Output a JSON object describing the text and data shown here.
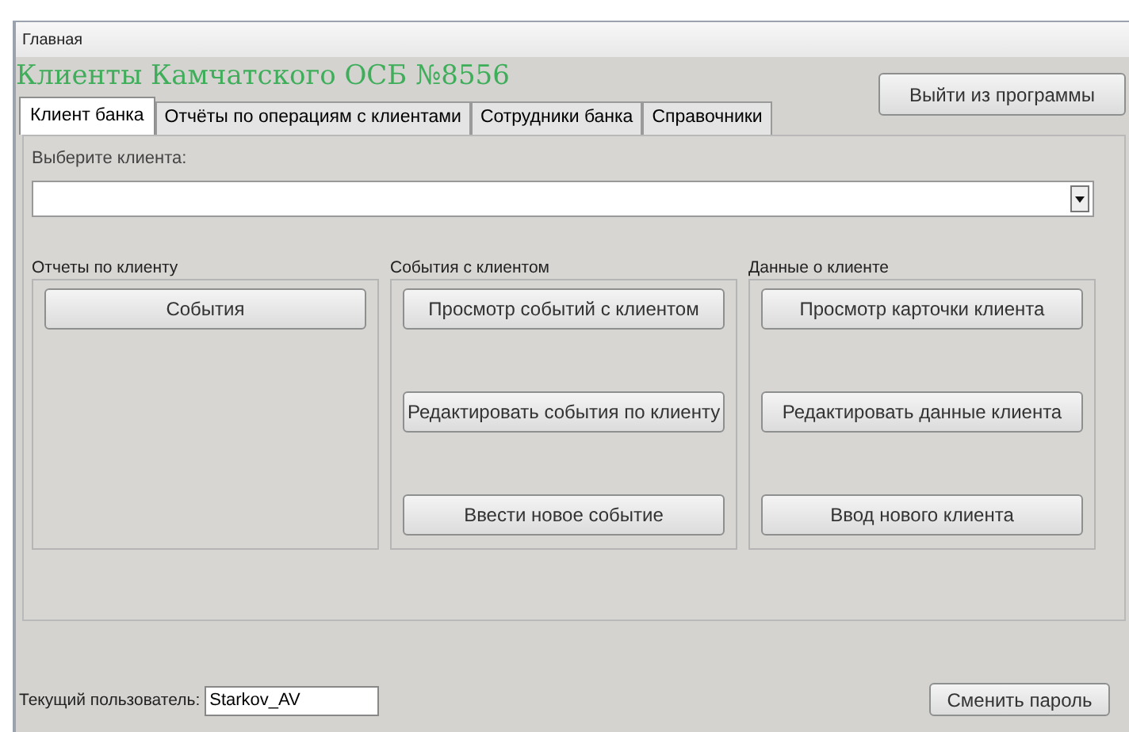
{
  "window": {
    "title": "Главная"
  },
  "header": {
    "title": "Клиенты Камчатского ОСБ №8556"
  },
  "exit_button": "Выйти из программы",
  "tabs": [
    {
      "label": "Клиент банка",
      "selected": true
    },
    {
      "label": "Отчёты по операциям с клиентами",
      "selected": false
    },
    {
      "label": "Сотрудники банка",
      "selected": false
    },
    {
      "label": "Справочники",
      "selected": false
    }
  ],
  "client_select": {
    "label": "Выберите клиента:"
  },
  "groups": [
    {
      "title": "Отчеты по клиенту",
      "buttons": [
        "События"
      ]
    },
    {
      "title": "События с клиентом",
      "buttons": [
        "Просмотр событий с клиентом",
        "Редактировать события по клиенту",
        "Ввести новое событие"
      ]
    },
    {
      "title": "Данные о клиенте",
      "buttons": [
        "Просмотр карточки клиента",
        "Редактировать данные клиента",
        "Ввод нового клиента"
      ]
    }
  ],
  "status": {
    "user_label": "Текущий пользователь:",
    "user_value": "Starkov_AV",
    "change_password_button": "Сменить пароль"
  }
}
